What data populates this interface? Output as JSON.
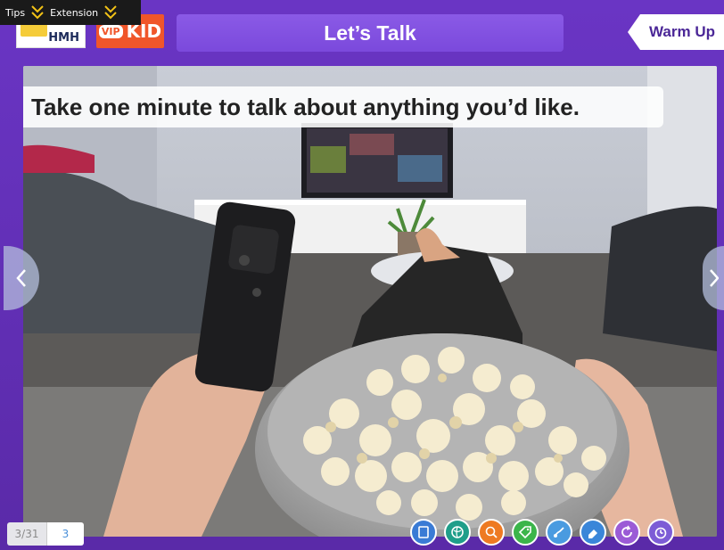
{
  "topbar": {
    "tips_label": "Tips",
    "extension_label": "Extension"
  },
  "logos": {
    "hmh": "HMH",
    "vip_badge": "VIP",
    "vip_text": "KID"
  },
  "header": {
    "title": "Let’s Talk",
    "warmup_label": "Warm Up"
  },
  "slide": {
    "caption": "Take one minute to talk about anything you’d like."
  },
  "pager": {
    "current": "3/31",
    "input_value": "3"
  },
  "tools": [
    {
      "name": "board-icon",
      "color": "#3a7bd5"
    },
    {
      "name": "globe-icon",
      "color": "#1f9e8a"
    },
    {
      "name": "magnify-icon",
      "color": "#ee7a22"
    },
    {
      "name": "tag-icon",
      "color": "#3bb54a"
    },
    {
      "name": "brush-icon",
      "color": "#4a9be0"
    },
    {
      "name": "eraser-icon",
      "color": "#3a86d9"
    },
    {
      "name": "refresh-icon",
      "color": "#9b5bd6"
    },
    {
      "name": "timer-icon",
      "color": "#7d5cd6"
    }
  ],
  "colors": {
    "frame": "#5c2fb3",
    "title_bar": "#7b49dc",
    "vip_orange": "#f0562a"
  }
}
